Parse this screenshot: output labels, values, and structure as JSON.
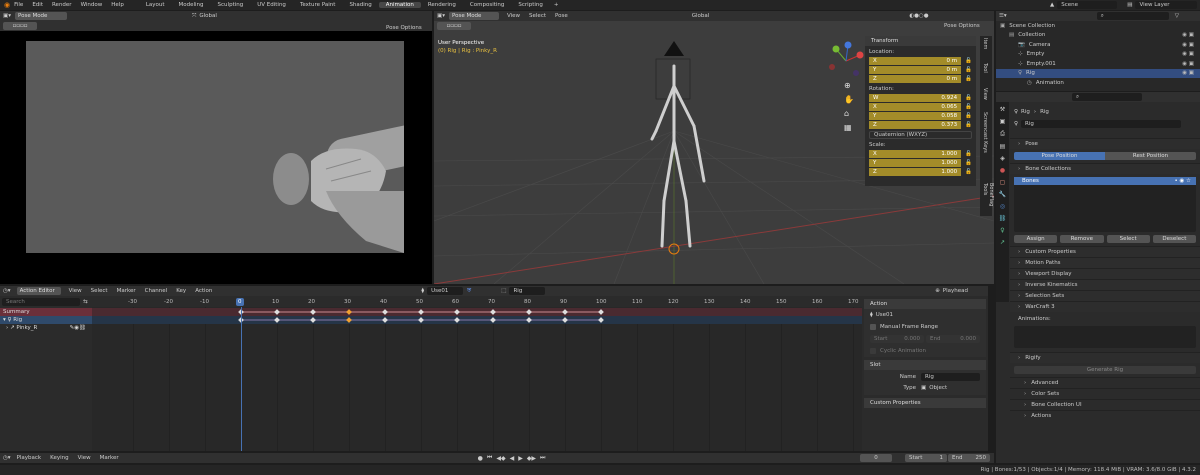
{
  "topbar": {
    "menus": [
      "File",
      "Edit",
      "Render",
      "Window",
      "Help"
    ],
    "workspaces": [
      "Layout",
      "Modeling",
      "Sculpting",
      "UV Editing",
      "Texture Paint",
      "Shading",
      "Animation",
      "Rendering",
      "Compositing",
      "Scripting"
    ],
    "active_workspace": "Animation",
    "scene": "Scene",
    "view_layer": "View Layer"
  },
  "camview": {
    "mode": "Pose Mode",
    "orientation": "Global",
    "pose_options": "Pose Options"
  },
  "viewport": {
    "mode": "Pose Mode",
    "menus": [
      "View",
      "Select",
      "Pose"
    ],
    "orientation": "Global",
    "pose_options": "Pose Options",
    "title": "User Perspective",
    "subtitle": "(0) Rig | Rig : Pinky_R",
    "sidebar_tabs": [
      "Item",
      "Tool",
      "View",
      "Screencast Keys",
      "BoneFlag Tools"
    ],
    "transform": {
      "header": "Transform",
      "location_label": "Location:",
      "location": [
        {
          "axis": "X",
          "value": "0 m"
        },
        {
          "axis": "Y",
          "value": "0 m"
        },
        {
          "axis": "Z",
          "value": "0 m"
        }
      ],
      "rotation_label": "Rotation:",
      "rotation": [
        {
          "axis": "W",
          "value": "0.924"
        },
        {
          "axis": "X",
          "value": "0.065"
        },
        {
          "axis": "Y",
          "value": "0.058"
        },
        {
          "axis": "Z",
          "value": "0.373"
        }
      ],
      "rotation_mode": "Quaternion (WXYZ)",
      "scale_label": "Scale:",
      "scale": [
        {
          "axis": "X",
          "value": "1.000"
        },
        {
          "axis": "Y",
          "value": "1.000"
        },
        {
          "axis": "Z",
          "value": "1.000"
        }
      ]
    }
  },
  "outliner": {
    "search_placeholder": "",
    "items": [
      {
        "name": "Scene Collection",
        "indent": 0
      },
      {
        "name": "Collection",
        "indent": 1
      },
      {
        "name": "Camera",
        "indent": 2
      },
      {
        "name": "Empty",
        "indent": 2
      },
      {
        "name": "Empty.001",
        "indent": 2
      },
      {
        "name": "Rig",
        "indent": 2
      },
      {
        "name": "Animation",
        "indent": 3
      }
    ]
  },
  "properties": {
    "path": [
      "Rig",
      "Rig"
    ],
    "name": "Rig",
    "pose": {
      "header": "Pose",
      "pose_position": "Pose Position",
      "rest_position": "Rest Position"
    },
    "bone_collections": {
      "header": "Bone Collections",
      "items": [
        "Bones"
      ],
      "buttons": [
        "Assign",
        "Remove",
        "Select",
        "Deselect"
      ]
    },
    "sections": [
      "Custom Properties",
      "Motion Paths",
      "Viewport Display",
      "Inverse Kinematics",
      "Selection Sets"
    ],
    "warcraft": {
      "header": "WarCraft 3",
      "animations_label": "Animations:"
    },
    "rigify": {
      "header": "Rigify",
      "generate": "Generate Rig",
      "subs": [
        "Advanced",
        "Color Sets",
        "Bone Collection UI",
        "Actions"
      ]
    }
  },
  "dopesheet": {
    "editor": "Action Editor",
    "menus": [
      "View",
      "Select",
      "Marker",
      "Channel",
      "Key",
      "Action"
    ],
    "action": "Use01",
    "slot": "Rig",
    "playhead": "Playhead",
    "search_placeholder": "Search",
    "ruler": [
      "-30",
      "-20",
      "-10",
      "0",
      "10",
      "20",
      "30",
      "40",
      "50",
      "60",
      "70",
      "80",
      "90",
      "100",
      "110",
      "120",
      "130",
      "140",
      "150",
      "160",
      "170"
    ],
    "current_frame_label": "0",
    "channels": [
      "Summary",
      "Rig",
      "Pinky_R"
    ],
    "keyframes": [
      0,
      10,
      20,
      30,
      40,
      50,
      60,
      70,
      80,
      90,
      100
    ],
    "selected_key": 30
  },
  "action_panel": {
    "header": "Action",
    "action_name": "Use01",
    "manual_frame_range": "Manual Frame Range",
    "start_label": "Start",
    "start_value": "0.000",
    "end_label": "End",
    "end_value": "0.000",
    "cyclic": "Cyclic Animation",
    "slot_header": "Slot",
    "name_label": "Name",
    "name_value": "Rig",
    "type_label": "Type",
    "type_value": "Object",
    "custom_properties": "Custom Properties"
  },
  "timeline": {
    "menus": [
      "Playback",
      "Keying",
      "View",
      "Marker"
    ],
    "current": "0",
    "start_label": "Start",
    "start": "1",
    "end_label": "End",
    "end": "250"
  },
  "statusbar": {
    "text": "Rig | Bones:1/53 | Objects:1/4 | Memory: 118.4 MiB | VRAM: 3.6/8.0 GiB | 4.3.2"
  }
}
